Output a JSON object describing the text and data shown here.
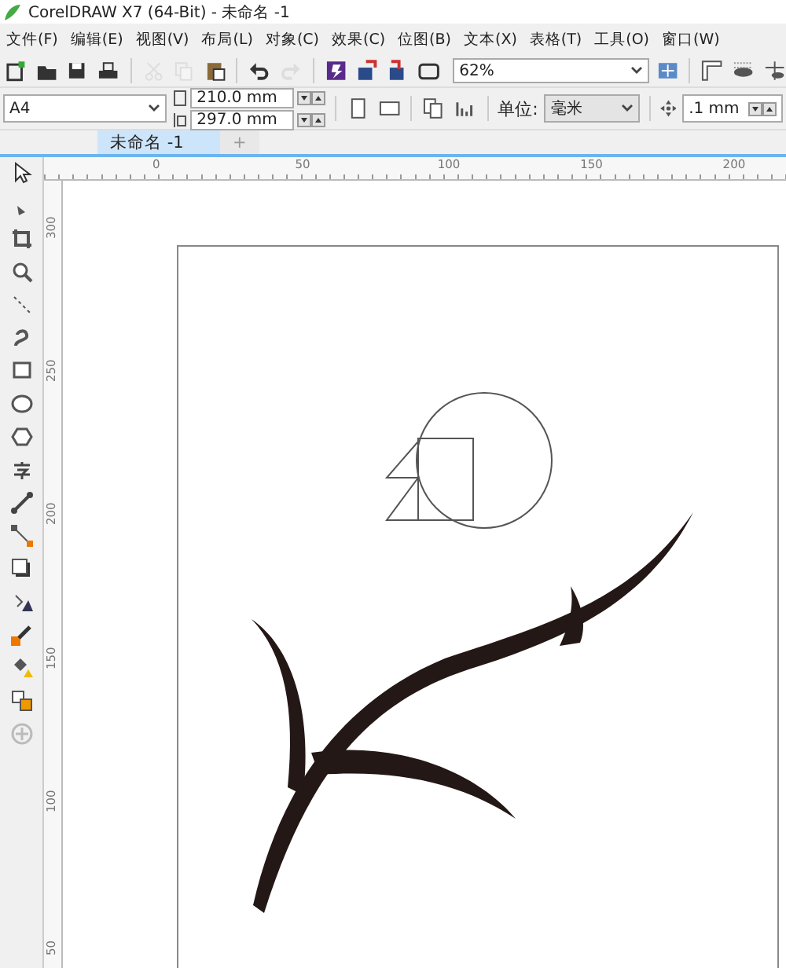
{
  "window": {
    "title": "CorelDRAW X7 (64-Bit) - 未命名 -1"
  },
  "menu": [
    "文件(F)",
    "编辑(E)",
    "视图(V)",
    "布局(L)",
    "对象(C)",
    "效果(C)",
    "位图(B)",
    "文本(X)",
    "表格(T)",
    "工具(O)",
    "窗口(W)"
  ],
  "toolbar": {
    "items": [
      {
        "kind": "new",
        "disabled": false
      },
      {
        "kind": "open",
        "disabled": false
      },
      {
        "kind": "save",
        "disabled": false
      },
      {
        "kind": "print",
        "disabled": false
      },
      {
        "kind": "sep"
      },
      {
        "kind": "cut",
        "disabled": true
      },
      {
        "kind": "copy",
        "disabled": true
      },
      {
        "kind": "paste",
        "disabled": false
      },
      {
        "kind": "sep"
      },
      {
        "kind": "undo",
        "disabled": false
      },
      {
        "kind": "redo",
        "disabled": true
      },
      {
        "kind": "sep"
      },
      {
        "kind": "launcher",
        "disabled": false
      },
      {
        "kind": "import",
        "disabled": false
      },
      {
        "kind": "export",
        "disabled": false
      },
      {
        "kind": "publish",
        "disabled": false
      }
    ],
    "zoom": "62%"
  },
  "property_bar": {
    "page_size": "A4",
    "width": "210.0 mm",
    "height": "297.0 mm",
    "units_label": "单位:",
    "units": "毫米",
    "nudge": ".1 mm"
  },
  "tabs": [
    {
      "label": "未命名 -1",
      "selected": true
    },
    {
      "label": "+",
      "selected": false
    }
  ],
  "rulers": {
    "horizontal": [
      "0",
      "50",
      "100",
      "150",
      "200"
    ],
    "vertical": [
      "300",
      "250",
      "200",
      "150",
      "100",
      "50"
    ]
  }
}
